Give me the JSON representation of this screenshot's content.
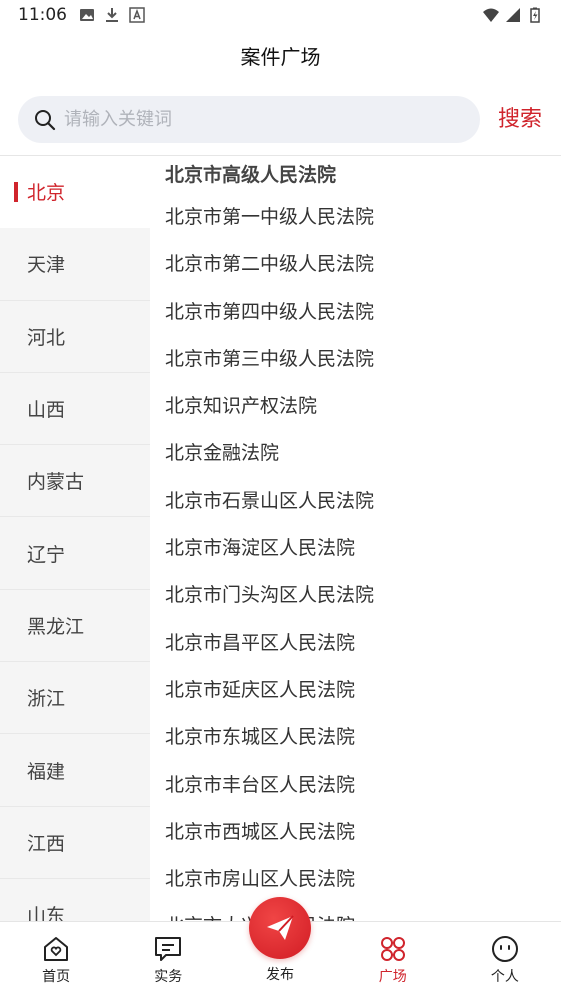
{
  "status": {
    "time": "11:06"
  },
  "header": {
    "title": "案件广场"
  },
  "search": {
    "placeholder": "请输入关键词",
    "button_label": "搜索"
  },
  "sidebar": {
    "items": [
      {
        "label": "北京",
        "active": true
      },
      {
        "label": "天津"
      },
      {
        "label": "河北"
      },
      {
        "label": "山西"
      },
      {
        "label": "内蒙古"
      },
      {
        "label": "辽宁"
      },
      {
        "label": "黑龙江"
      },
      {
        "label": "浙江"
      },
      {
        "label": "福建"
      },
      {
        "label": "江西"
      },
      {
        "label": "山东"
      }
    ]
  },
  "courts": {
    "header": "北京市高级人民法院",
    "items": [
      "北京市第一中级人民法院",
      "北京市第二中级人民法院",
      "北京市第四中级人民法院",
      "北京市第三中级人民法院",
      "北京知识产权法院",
      "北京金融法院",
      "北京市石景山区人民法院",
      "北京市海淀区人民法院",
      "北京市门头沟区人民法院",
      "北京市昌平区人民法院",
      "北京市延庆区人民法院",
      "北京市东城区人民法院",
      "北京市丰台区人民法院",
      "北京市西城区人民法院",
      "北京市房山区人民法院",
      "北京市大兴区人民法院"
    ]
  },
  "nav": {
    "home": "首页",
    "practice": "实务",
    "publish": "发布",
    "square": "广场",
    "profile": "个人"
  },
  "colors": {
    "accent": "#d0242c"
  }
}
